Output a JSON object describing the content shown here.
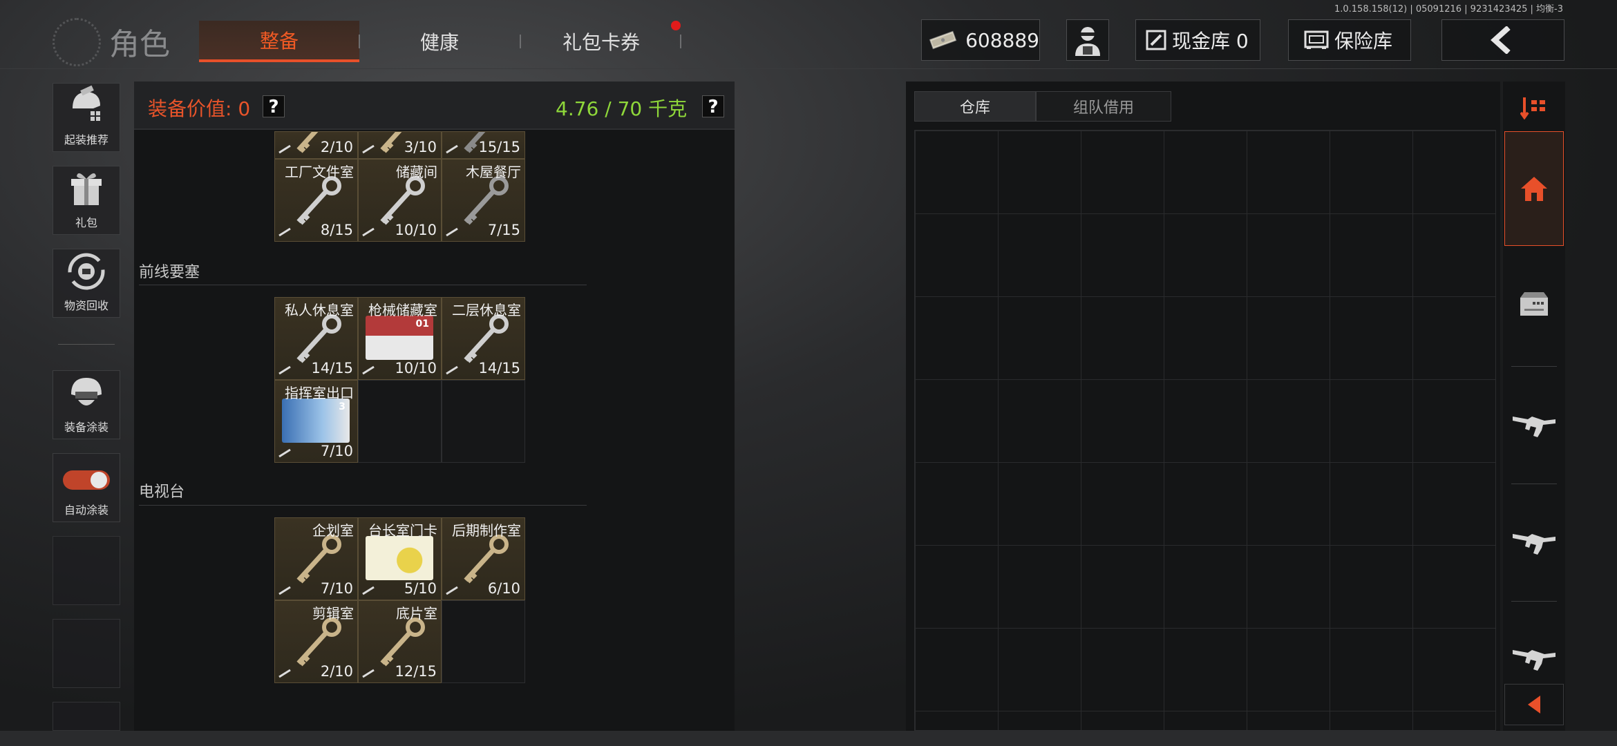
{
  "version": "1.0.158.158(12) | 05091216 | 9231423425 | 均衡-3",
  "header": {
    "title": "角色",
    "tabs": [
      "整备",
      "健康",
      "礼包卡券"
    ],
    "money": "608889",
    "cash_vault": "现金库 0",
    "safe": "保险库"
  },
  "left_menu": [
    "起装推荐",
    "礼包",
    "物资回收",
    "装备涂装",
    "自动涂装"
  ],
  "panel": {
    "value_label": "装备价值: 0",
    "help": "?",
    "weight": "4.76 / 70 千克"
  },
  "sections": [
    "前线要塞",
    "电视台"
  ],
  "key_cells": [
    {
      "name": "",
      "count": "2/10",
      "art": "key-brass"
    },
    {
      "name": "",
      "count": "3/10",
      "art": "key-brass"
    },
    {
      "name": "",
      "count": "15/15",
      "art": "key-dark"
    },
    {
      "name": "工厂文件室",
      "count": "8/15",
      "art": "key-silver"
    },
    {
      "name": "储藏间",
      "count": "10/10",
      "art": "key-silver"
    },
    {
      "name": "木屋餐厅",
      "count": "7/15",
      "art": "key-gray"
    },
    {
      "name": "私人休息室",
      "count": "14/15",
      "art": "key-silver"
    },
    {
      "name": "枪械储藏室",
      "count": "10/10",
      "art": "card-red"
    },
    {
      "name": "二层休息室",
      "count": "14/15",
      "art": "key-silver"
    },
    {
      "name": "指挥室出口",
      "count": "7/10",
      "art": "card-blue"
    },
    {
      "name": "",
      "count": "",
      "art": ""
    },
    {
      "name": "",
      "count": "",
      "art": ""
    },
    {
      "name": "企划室",
      "count": "7/10",
      "art": "key-brass"
    },
    {
      "name": "台长室门卡",
      "count": "5/10",
      "art": "card-yellow"
    },
    {
      "name": "后期制作室",
      "count": "6/10",
      "art": "key-brass"
    },
    {
      "name": "剪辑室",
      "count": "2/10",
      "art": "key-brass"
    },
    {
      "name": "底片室",
      "count": "12/15",
      "art": "key-brass"
    },
    {
      "name": "",
      "count": "",
      "art": ""
    }
  ],
  "card_labels": {
    "card-red": "01",
    "card-blue": "3"
  },
  "storage": {
    "tabs": [
      "仓库",
      "组队借用"
    ]
  },
  "colors": {
    "accent": "#e8502a",
    "weight_green": "#8fd83a",
    "cell_bg": "#3a3222"
  }
}
